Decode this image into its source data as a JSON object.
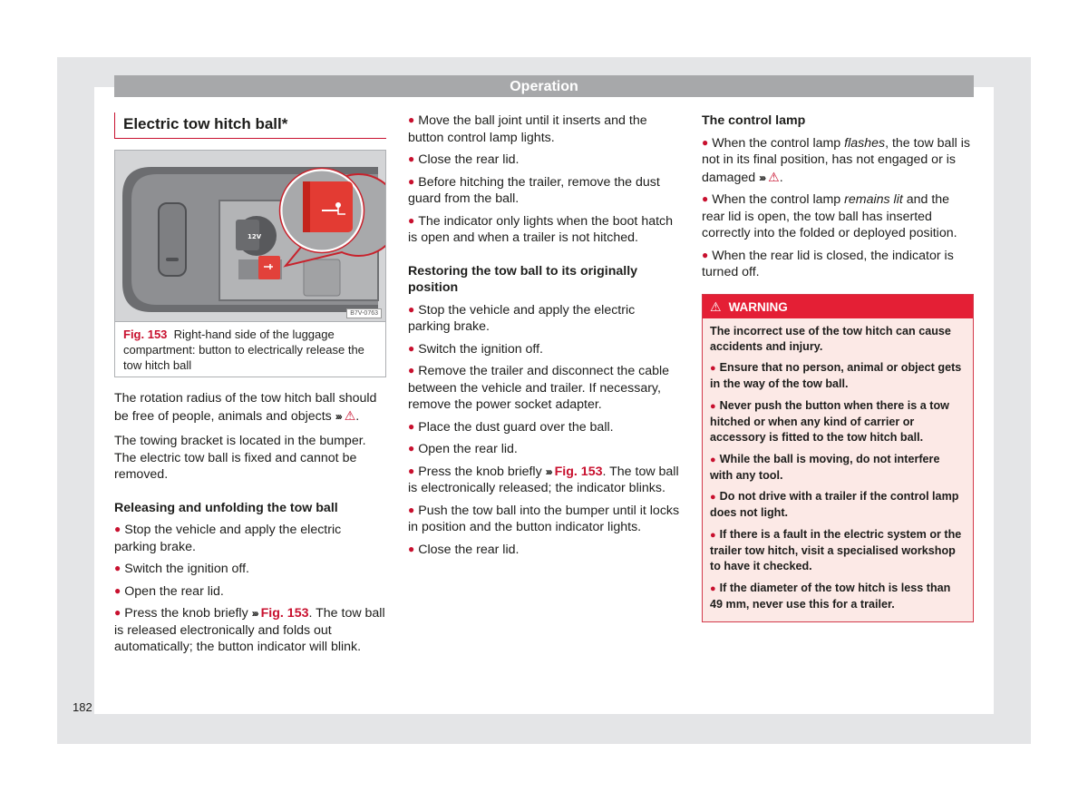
{
  "header": {
    "section": "Operation"
  },
  "page_number": "182",
  "colors": {
    "accent": "#c8102e",
    "warning_header": "#e41f35",
    "warning_bg": "#fce9e6",
    "header_bar": "#a7a8aa",
    "frame": "#e4e5e7"
  },
  "column1": {
    "title": "Electric tow hitch ball*",
    "figure": {
      "image_code": "B7V-0763",
      "socket_label": "12V",
      "caption_ref": "Fig. 153",
      "caption_text": "Right-hand side of the luggage compartment: button to electrically release the tow hitch ball"
    },
    "para1": {
      "text": "The rotation radius of the tow hitch ball should be free of people, animals and objects",
      "ref_arrows": "›››",
      "ref_icon": "warning-icon"
    },
    "para2": "The towing bracket is located in the bumper. The electric tow ball is fixed and cannot be removed.",
    "releasing": {
      "heading": "Releasing and unfolding the tow ball",
      "items": [
        "Stop the vehicle and apply the electric parking brake.",
        "Switch the ignition off.",
        "Open the rear lid."
      ],
      "press_item": {
        "before": "Press the knob briefly",
        "arrows": "›››",
        "ref": "Fig. 153",
        "after": ". The tow ball is released electronically and folds out automatically; the button indicator will blink."
      }
    }
  },
  "column2": {
    "items_top": [
      "Move the ball joint until it inserts and the button control lamp lights.",
      "Close the rear lid.",
      "Before hitching the trailer, remove the dust guard from the ball.",
      "The indicator only lights when the boot hatch is open and when a trailer is not hitched."
    ],
    "restoring": {
      "heading": "Restoring the tow ball to its originally position",
      "items": [
        "Stop the vehicle and apply the electric parking brake.",
        "Switch the ignition off.",
        "Remove the trailer and disconnect the cable between the vehicle and trailer. If necessary, remove the power socket adapter.",
        "Place the dust guard over the ball.",
        "Open the rear lid."
      ],
      "press_item": {
        "before": "Press the knob briefly",
        "arrows": "›››",
        "ref": "Fig. 153",
        "after": ". The tow ball is electronically released; the indicator blinks."
      },
      "items_after": [
        "Push the tow ball into the bumper until it locks in position and the button indicator lights.",
        "Close the rear lid."
      ]
    }
  },
  "column3": {
    "control_lamp": {
      "heading": "The control lamp",
      "item1": {
        "before": "When the control lamp ",
        "em": "flashes",
        "after": ", the tow ball is not in its final position, has not engaged or is damaged",
        "arrows": "›››"
      },
      "item2": {
        "before": "When the control lamp ",
        "em": "remains lit",
        "after": " and the rear lid is open, the tow ball has inserted correctly into the folded or deployed position."
      },
      "item3": "When the rear lid is closed, the indicator is turned off."
    },
    "warning": {
      "label": "WARNING",
      "intro": "The incorrect use of the tow hitch can cause accidents and injury.",
      "items": [
        "Ensure that no person, animal or object gets in the way of the tow ball.",
        "Never push the button when there is a tow hitched or when any kind of carrier or accessory is fitted to the tow hitch ball.",
        "While the ball is moving, do not interfere with any tool.",
        "Do not drive with a trailer if the control lamp does not light.",
        "If there is a fault in the electric system or the trailer tow hitch, visit a specialised workshop to have it checked.",
        "If the diameter of the tow hitch is less than 49 mm, never use this for a trailer."
      ]
    }
  }
}
